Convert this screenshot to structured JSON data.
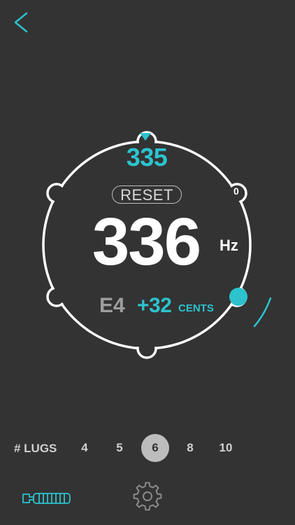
{
  "tuner": {
    "target_frequency": "335",
    "reset_label": "RESET",
    "current_lug": "0",
    "frequency": "336",
    "frequency_unit": "Hz",
    "note": "E4",
    "cents": "+32",
    "cents_unit": "CENTS"
  },
  "lugs": {
    "label": "# LUGS",
    "options": [
      "4",
      "5",
      "6",
      "8",
      "10"
    ],
    "selected": "6"
  },
  "icons": {
    "back": "chevron-left-icon",
    "tuning_key": "drum-key-icon",
    "settings": "gear-icon"
  },
  "colors": {
    "background": "#333333",
    "accent": "#2CC3CE",
    "foreground": "#FFFFFF",
    "muted": "#9E9E9E"
  }
}
